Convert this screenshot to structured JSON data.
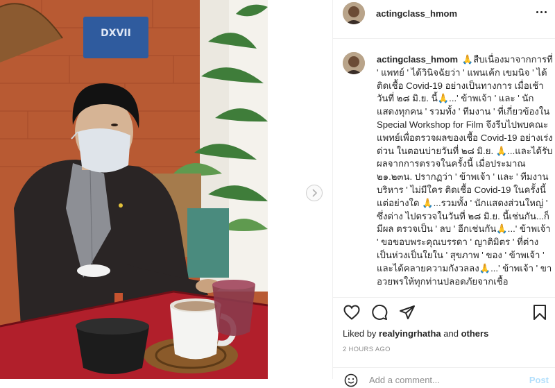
{
  "post": {
    "username": "actingclass_hmom",
    "more_icon": "more-horizontal-icon",
    "photo_sign_text": "DXVII"
  },
  "caption": {
    "username": "actingclass_hmom",
    "text": "🙏สืบเนื่องมาจากการที่ ' แพทย์ ' ได้วินิจฉัยว่า ' แพนเค้ก เขมนิจ ' ได้ติดเชื้อ Covid-19 อย่างเป็นทางการ เมื่อเช้าวันที่ ๒๘ มิ.ย. นี้🙏...' ข้าพเจ้า ' และ ' นักแสดงทุกคน ' รวมทั้ง ' ทีมงาน ' ที่เกี่ยวข้องใน Special Workshop for Film จึงรีบไปพบคณะแพทย์เพื่อตรวจผลของเชื้อ Covid-19 อย่างเร่งด่วน ในตอนบ่ายวันที่ ๒๘ มิ.ย. 🙏...และได้รับผลจากการตรวจในครั้งนี้ เมื่อประมาณ ๒๑.๒๓น. ปรากฏว่า ' ข้าพเจ้า ' และ ' ทีมงานบริหาร ' ไม่มีใคร ติดเชื้อ Covid-19 ในครั้งนี้แต่อย่างใด 🙏...รวมทั้ง ' นักแสดงส่วนใหญ่ ' ซึ่งต่าง ไปตรวจในวันที่ ๒๘ มิ.ย. นี้เช่นกัน...ก็มีผล ตรวจเป็น ' ลบ ' อีกเช่นกัน🙏...' ข้าพเจ้า ' ขอขอบพระคุณบรรดา ' ญาติมิตร ' ที่ต่าง เป็นห่วงเป็นใยใน ' สุขภาพ ' ของ ' ข้าพเจ้า ' และได้คลายความกังวลลง🙏...' ข้าพเจ้า ' ขาอวยพรให้ทุกท่านปลอดภัยจากเชื้อ"
  },
  "actions": {
    "like_icon": "heart-icon",
    "comment_icon": "comment-bubble-icon",
    "share_icon": "paper-plane-icon",
    "save_icon": "bookmark-icon"
  },
  "likes": {
    "prefix": "Liked by ",
    "user": "realyingrhatha",
    "connector": " and ",
    "others": "others"
  },
  "timestamp": "2 HOURS AGO",
  "add_comment": {
    "placeholder": "Add a comment...",
    "post_label": "Post",
    "emoji_icon": "smile-icon"
  },
  "navigation": {
    "next_icon": "chevron-right-icon"
  },
  "colors": {
    "text": "#262626",
    "muted": "#8e8e8e",
    "divider": "#efefef",
    "post_disabled": "#b2dffc"
  }
}
